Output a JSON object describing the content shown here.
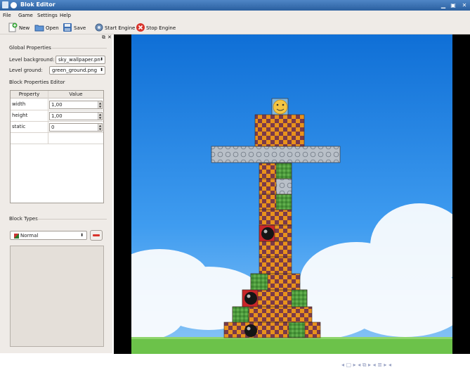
{
  "window": {
    "title": "Blok Editor"
  },
  "menu": {
    "items": [
      "File",
      "Game",
      "Settings",
      "Help"
    ]
  },
  "toolbar": {
    "new_label": "New",
    "open_label": "Open",
    "save_label": "Save",
    "start_label": "Start Engine",
    "stop_label": "Stop Engine"
  },
  "global_properties": {
    "title": "Global Properties",
    "background_label": "Level background:",
    "background_value": "sky_wallpaper.pn",
    "ground_label": "Level ground:",
    "ground_value": "green_ground.png"
  },
  "block_editor": {
    "title": "Block Properties Editor",
    "col_property": "Property",
    "col_value": "Value",
    "rows": [
      {
        "property": "width",
        "value": "1,00"
      },
      {
        "property": "height",
        "value": "1,00"
      },
      {
        "property": "static",
        "value": "0"
      }
    ]
  },
  "block_types": {
    "title": "Block Types",
    "selected": "Normal"
  },
  "nav_glyphs": "◂ ▢ ▸ ◂ ⧉ ▸ ◂ ≣ ▸ ◂",
  "colors": {
    "titlebar": "#2f66a8",
    "panel": "#efebe7",
    "checker_orange": "#e8921c",
    "checker_purple": "#7a3a4a",
    "sky_top": "#1272d8",
    "ground": "#6cc24a"
  }
}
